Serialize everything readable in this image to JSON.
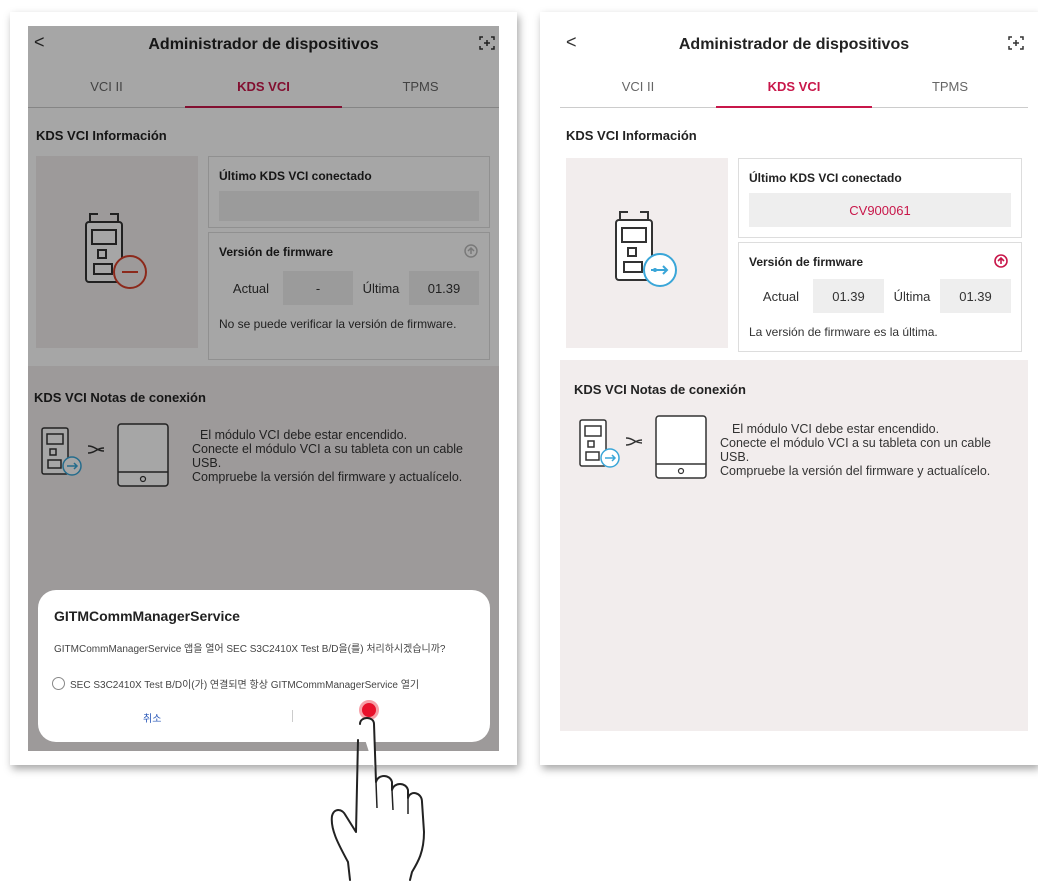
{
  "header": {
    "back": "<",
    "title": "Administrador de dispositivos"
  },
  "tabs": [
    "VCI II",
    "KDS VCI",
    "TPMS"
  ],
  "info": {
    "section_title": "KDS VCI Información",
    "last_connected_label": "Último KDS VCI conectado",
    "firmware_label": "Versión de firmware",
    "current_label": "Actual",
    "latest_label": "Última"
  },
  "left": {
    "last_connected_value": "",
    "firmware_current": "-",
    "firmware_latest": "01.39",
    "firmware_note": "No se puede verificar la versión de firmware."
  },
  "right": {
    "last_connected_value": "CV900061",
    "firmware_current": "01.39",
    "firmware_latest": "01.39",
    "firmware_note": "La versión de firmware es la última."
  },
  "notes": {
    "title": "KDS VCI Notas de conexión",
    "line1": "El módulo VCI debe estar encendido.",
    "line2": "Conecte el módulo VCI a su tableta con un cable USB.",
    "line3": "Compruebe la versión del firmware y actualícelo."
  },
  "dialog": {
    "title": "GITMCommManagerService",
    "message": "GITMCommManagerService 앱을 열어 SEC S3C2410X Test B/D을(를) 처리하시겠습니까?",
    "option": "SEC S3C2410X Test B/D이(가) 연결되면 항상 GITMCommManagerService 열기",
    "cancel": "취소"
  },
  "colors": {
    "accent": "#c8174a",
    "usb_blue": "#3aa6d8",
    "error_red": "#d8402a"
  }
}
